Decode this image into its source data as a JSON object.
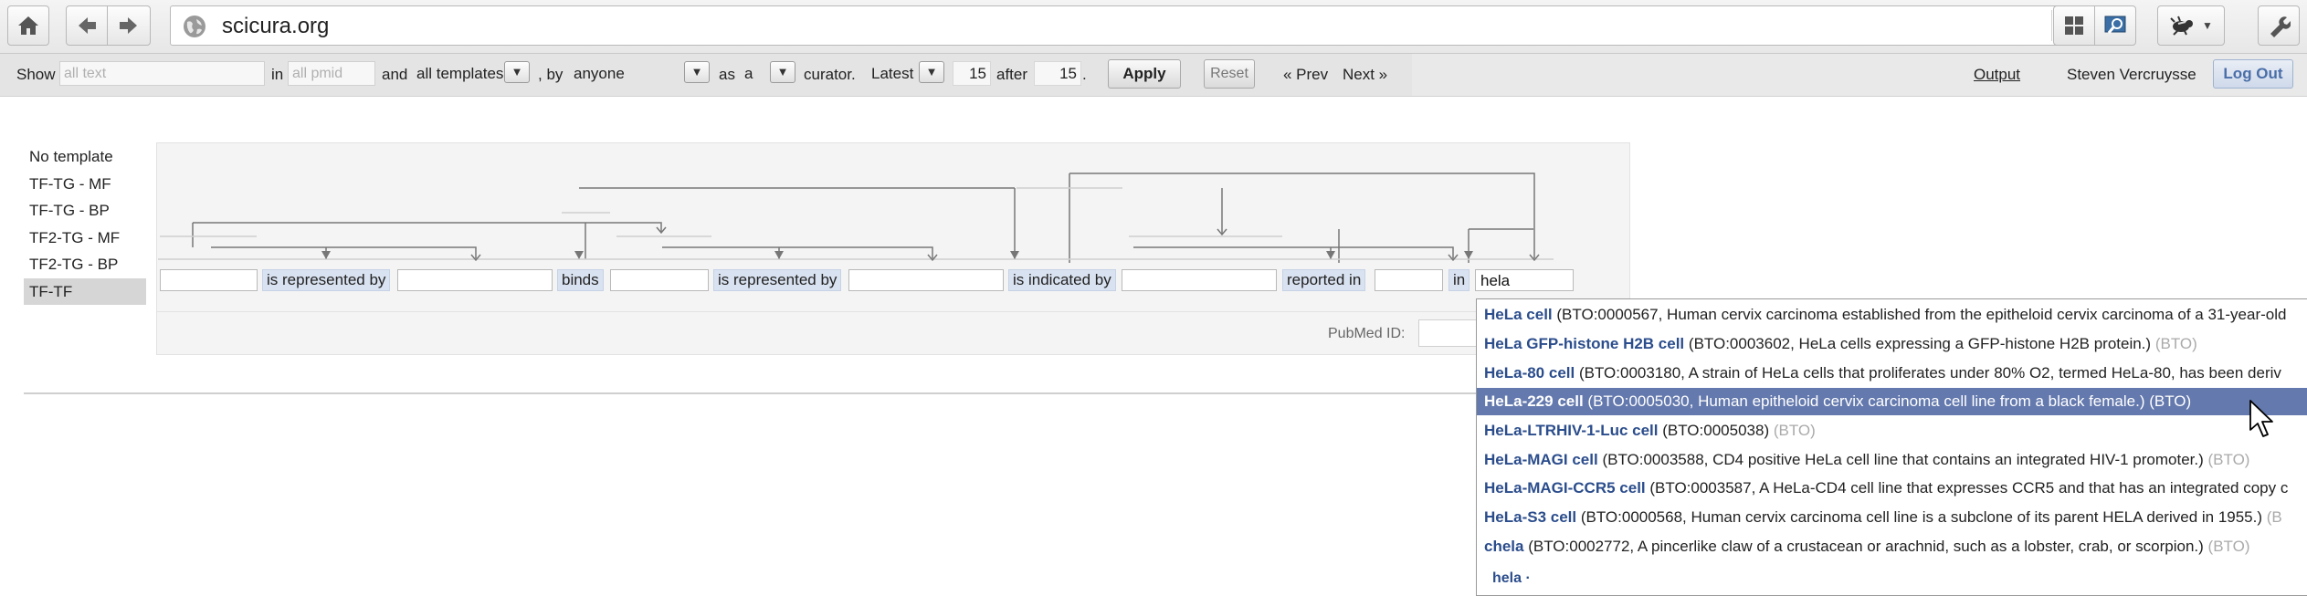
{
  "browser": {
    "url": "scicura.org",
    "icons": [
      "home-icon",
      "back-arrow-icon",
      "forward-arrow-icon",
      "globe-icon",
      "reload-icon",
      "grid-icon",
      "screenshot-icon",
      "bug-icon",
      "chevron-down-icon",
      "wrench-icon"
    ]
  },
  "toolbar": {
    "show_label": "Show",
    "text_placeholder": "all text",
    "in_label": "in",
    "pmid_placeholder": "all pmid",
    "and_label": "and",
    "templates_value": "all templates",
    "by_label": ", by",
    "by_value": "anyone",
    "as_label": "as",
    "as_value": "a",
    "curator_label": "curator.",
    "order_value": "Latest",
    "count_value": "15",
    "after_label": "after",
    "after_value": "15",
    "dot": ".",
    "apply_label": "Apply",
    "reset_label": "Reset",
    "prev_label": "« Prev",
    "next_label": "Next »",
    "output_label": "Output",
    "user_name": "Steven Vercruysse",
    "logout_label": "Log Out"
  },
  "templates": [
    {
      "label": "No template",
      "active": false
    },
    {
      "label": "TF-TG - MF",
      "active": false
    },
    {
      "label": "TF-TG - BP",
      "active": false
    },
    {
      "label": "TF2-TG - MF",
      "active": false
    },
    {
      "label": "TF2-TG - BP",
      "active": false
    },
    {
      "label": "TF-TF",
      "active": true
    }
  ],
  "sentence": {
    "relations": [
      "is represented by",
      "binds",
      "is represented by",
      "is indicated by",
      "reported in",
      "in"
    ],
    "last_input_value": "hela",
    "pubmed_label": "PubMed ID:"
  },
  "autocomplete": {
    "items": [
      {
        "term": "HeLa cell",
        "desc": "(BTO:0000567, Human cervix carcinoma established from the epitheloid cervix carcinoma of a 31-year-old",
        "src": ""
      },
      {
        "term": "HeLa GFP-histone H2B cell",
        "desc": "(BTO:0003602, HeLa cells expressing a GFP-histone H2B protein.)",
        "src": "(BTO)"
      },
      {
        "term": "HeLa-80 cell",
        "desc": "(BTO:0003180, A strain of HeLa cells that proliferates under 80% O2, termed HeLa-80, has been deriv",
        "src": ""
      },
      {
        "term": "HeLa-229 cell",
        "desc": "(BTO:0005030, Human epitheloid cervix carcinoma cell line from a black female.)",
        "src": "(BTO)"
      },
      {
        "term": "HeLa-LTRHIV-1-Luc cell",
        "desc": "(BTO:0005038)",
        "src": "(BTO)"
      },
      {
        "term": "HeLa-MAGI cell",
        "desc": "(BTO:0003588, CD4 positive HeLa cell line that contains an integrated HIV-1 promoter.)",
        "src": "(BTO)"
      },
      {
        "term": "HeLa-MAGI-CCR5 cell",
        "desc": "(BTO:0003587, A HeLa-CD4 cell line that expresses CCR5 and that has an integrated copy c",
        "src": ""
      },
      {
        "term": "HeLa-S3 cell",
        "desc": "(BTO:0000568, Human cervix carcinoma cell line is a subclone of its parent HELA derived in 1955.)",
        "src": "(B"
      },
      {
        "term": "chela",
        "desc": "(BTO:0002772, A pincerlike claw of a crustacean or arachnid, such as a lobster, crab, or scorpion.)",
        "src": "(BTO)"
      }
    ],
    "selected_index": 3,
    "footer": "hela ·"
  },
  "colors": {
    "highlight": "#6479ad",
    "term": "#2b4d8c",
    "relation_bg": "#d9e2f0"
  }
}
